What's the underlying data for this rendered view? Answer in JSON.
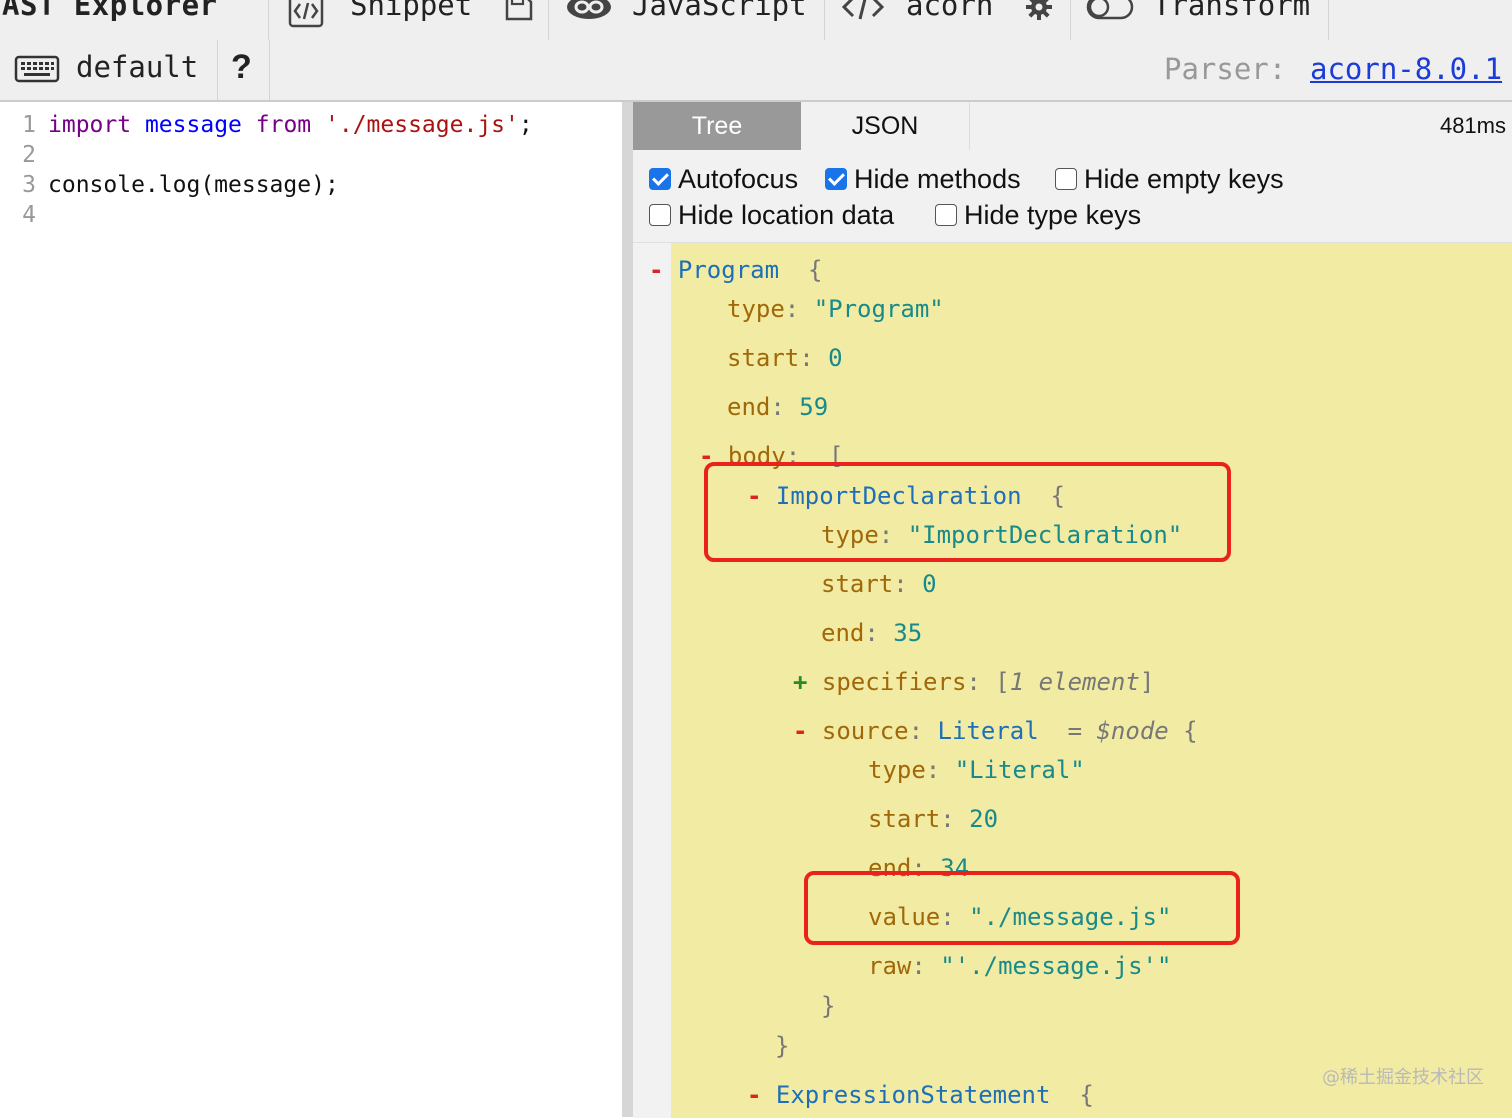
{
  "toolbar": {
    "brand": "AST Explorer",
    "snippet_label": "Snippet",
    "language_label": "JavaScript",
    "parser_menu_label": "acorn",
    "transform_label": "Transform",
    "keymap_label": "default",
    "help_label": "?",
    "parser_prefix": "Parser:",
    "parser_version": "acorn-8.0.1",
    "icons": [
      "snippet-icon",
      "save-icon",
      "language-icon",
      "code-icon",
      "gear-icon",
      "toggle-icon",
      "keyboard-icon",
      "help-icon"
    ]
  },
  "editor": {
    "lines": [
      {
        "num": "1",
        "tokens": [
          {
            "text": "import",
            "cls": "kw"
          },
          {
            "text": " ",
            "cls": ""
          },
          {
            "text": "message",
            "cls": "def"
          },
          {
            "text": " ",
            "cls": ""
          },
          {
            "text": "from",
            "cls": "kw"
          },
          {
            "text": " ",
            "cls": ""
          },
          {
            "text": "'./message.js'",
            "cls": "str"
          },
          {
            "text": ";",
            "cls": ""
          }
        ]
      },
      {
        "num": "2",
        "tokens": []
      },
      {
        "num": "3",
        "tokens": [
          {
            "text": "console.log(message);",
            "cls": ""
          }
        ]
      },
      {
        "num": "4",
        "tokens": []
      }
    ]
  },
  "output": {
    "tabs": [
      "Tree",
      "JSON"
    ],
    "active_tab": "Tree",
    "timing": "481ms",
    "options": [
      {
        "label": "Autofocus",
        "checked": true
      },
      {
        "label": "Hide methods",
        "checked": true
      },
      {
        "label": "Hide empty keys",
        "checked": false
      },
      {
        "label": "Hide location data",
        "checked": false
      },
      {
        "label": "Hide type keys",
        "checked": false
      }
    ],
    "tree": [
      {
        "parts": [
          {
            "t": "- ",
            "c": "toggle-minus"
          },
          {
            "t": "Program",
            "c": "nodetype"
          },
          {
            "t": "  {",
            "c": "punc"
          }
        ]
      },
      {
        "parts": [
          {
            "t": "type",
            "c": "key"
          },
          {
            "t": ": ",
            "c": "punc"
          },
          {
            "t": "\"Program\"",
            "c": "sval"
          }
        ]
      },
      {
        "parts": [
          {
            "t": "start",
            "c": "key"
          },
          {
            "t": ": ",
            "c": "punc"
          },
          {
            "t": "0",
            "c": "nval"
          }
        ]
      },
      {
        "parts": [
          {
            "t": "end",
            "c": "key"
          },
          {
            "t": ": ",
            "c": "punc"
          },
          {
            "t": "59",
            "c": "nval"
          }
        ]
      },
      {
        "parts": [
          {
            "t": "- ",
            "c": "toggle-minus"
          },
          {
            "t": "body",
            "c": "key"
          },
          {
            "t": ":  [",
            "c": "punc"
          }
        ]
      },
      {
        "parts": [
          {
            "t": "- ",
            "c": "toggle-minus"
          },
          {
            "t": "ImportDeclaration",
            "c": "nodetype"
          },
          {
            "t": "  {",
            "c": "punc"
          }
        ]
      },
      {
        "parts": [
          {
            "t": "type",
            "c": "key"
          },
          {
            "t": ": ",
            "c": "punc"
          },
          {
            "t": "\"ImportDeclaration\"",
            "c": "sval"
          }
        ]
      },
      {
        "parts": [
          {
            "t": "start",
            "c": "key"
          },
          {
            "t": ": ",
            "c": "punc"
          },
          {
            "t": "0",
            "c": "nval"
          }
        ]
      },
      {
        "parts": [
          {
            "t": "end",
            "c": "key"
          },
          {
            "t": ": ",
            "c": "punc"
          },
          {
            "t": "35",
            "c": "nval"
          }
        ]
      },
      {
        "parts": [
          {
            "t": "+ ",
            "c": "toggle-plus"
          },
          {
            "t": "specifiers",
            "c": "key"
          },
          {
            "t": ": [",
            "c": "punc"
          },
          {
            "t": "1 element",
            "c": "note"
          },
          {
            "t": "]",
            "c": "punc"
          }
        ]
      },
      {
        "parts": [
          {
            "t": "- ",
            "c": "toggle-minus"
          },
          {
            "t": "source",
            "c": "key"
          },
          {
            "t": ": ",
            "c": "punc"
          },
          {
            "t": "Literal",
            "c": "nodetype"
          },
          {
            "t": "  = ",
            "c": "punc"
          },
          {
            "t": "$node",
            "c": "note"
          },
          {
            "t": " {",
            "c": "punc"
          }
        ]
      },
      {
        "parts": [
          {
            "t": "type",
            "c": "key"
          },
          {
            "t": ": ",
            "c": "punc"
          },
          {
            "t": "\"Literal\"",
            "c": "sval"
          }
        ]
      },
      {
        "parts": [
          {
            "t": "start",
            "c": "key"
          },
          {
            "t": ": ",
            "c": "punc"
          },
          {
            "t": "20",
            "c": "nval"
          }
        ]
      },
      {
        "parts": [
          {
            "t": "end",
            "c": "key"
          },
          {
            "t": ": ",
            "c": "punc"
          },
          {
            "t": "34",
            "c": "nval"
          }
        ]
      },
      {
        "parts": [
          {
            "t": "value",
            "c": "key"
          },
          {
            "t": ": ",
            "c": "punc"
          },
          {
            "t": "\"./message.js\"",
            "c": "sval"
          }
        ]
      },
      {
        "parts": [
          {
            "t": "raw",
            "c": "key"
          },
          {
            "t": ": ",
            "c": "punc"
          },
          {
            "t": "\"'./message.js'\"",
            "c": "sval"
          }
        ]
      },
      {
        "parts": [
          {
            "t": "}",
            "c": "punc"
          }
        ]
      },
      {
        "parts": [
          {
            "t": "}",
            "c": "punc"
          }
        ]
      },
      {
        "parts": [
          {
            "t": "- ",
            "c": "toggle-minus"
          },
          {
            "t": "ExpressionStatement",
            "c": "nodetype"
          },
          {
            "t": "  {",
            "c": "punc"
          }
        ]
      }
    ]
  },
  "watermark": "@稀土掘金技术社区"
}
